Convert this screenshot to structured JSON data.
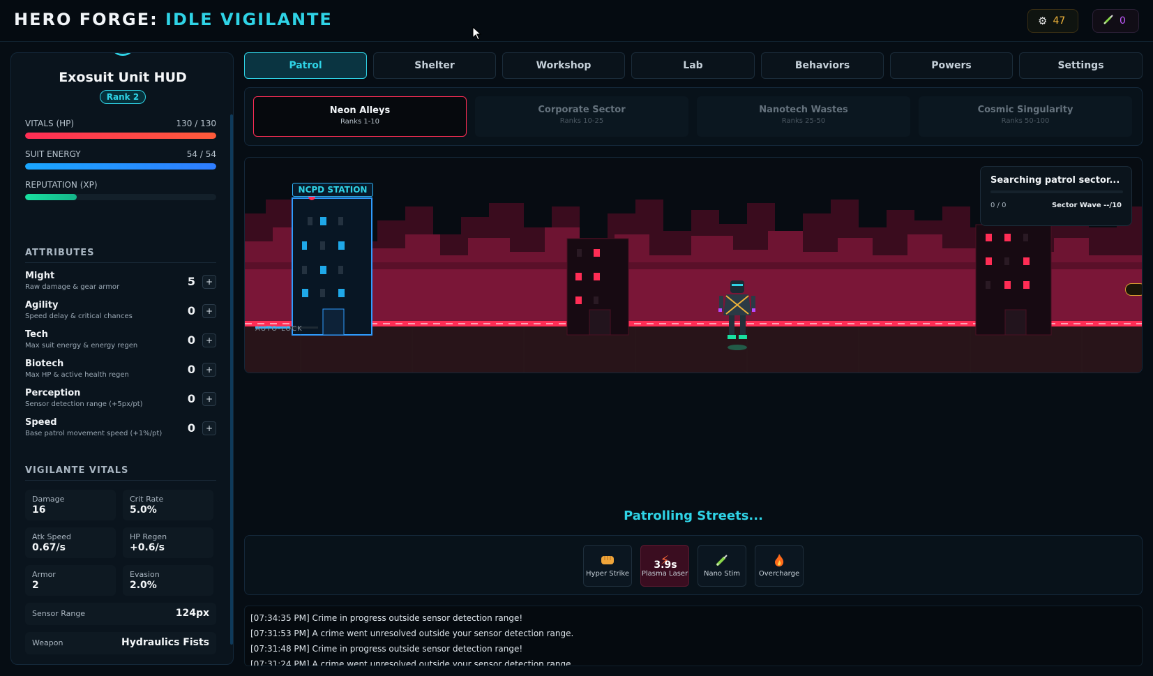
{
  "header": {
    "title_main": "HERO FORGE:",
    "title_accent": "IDLE VIGILANTE",
    "gears_count": "47",
    "syringe_count": "0",
    "gears_icon": "gear-icon",
    "syringe_icon": "syringe-icon"
  },
  "hud": {
    "title": "Exosuit Unit HUD",
    "rank": "Rank 2",
    "vitals_label": "VITALS (HP)",
    "vitals_value": "130 / 130",
    "vitals_fraction": 1.0,
    "energy_label": "SUIT ENERGY",
    "energy_value": "54 / 54",
    "energy_fraction": 1.0,
    "xp_label": "REPUTATION (XP)",
    "xp_fraction": 0.27
  },
  "attributes": {
    "heading": "ATTRIBUTES",
    "items": [
      {
        "name": "Might",
        "desc": "Raw damage & gear armor",
        "value": "5"
      },
      {
        "name": "Agility",
        "desc": "Speed delay & critical chances",
        "value": "0"
      },
      {
        "name": "Tech",
        "desc": "Max suit energy & energy regen",
        "value": "0"
      },
      {
        "name": "Biotech",
        "desc": "Max HP & active health regen",
        "value": "0"
      },
      {
        "name": "Perception",
        "desc": "Sensor detection range (+5px/pt)",
        "value": "0"
      },
      {
        "name": "Speed",
        "desc": "Base patrol movement speed (+1%/pt)",
        "value": "0"
      }
    ],
    "plus_label": "+"
  },
  "vitals": {
    "heading": "VIGILANTE VITALS",
    "stats": [
      {
        "label": "Damage",
        "value": "16"
      },
      {
        "label": "Crit Rate",
        "value": "5.0%"
      },
      {
        "label": "Atk Speed",
        "value": "0.67/s"
      },
      {
        "label": "HP Regen",
        "value": "+0.6/s"
      },
      {
        "label": "Armor",
        "value": "2"
      },
      {
        "label": "Evasion",
        "value": "2.0%"
      }
    ],
    "sensor_label": "Sensor Range",
    "sensor_value": "124px",
    "weapon_label": "Weapon",
    "weapon_value": "Hydraulics Fists"
  },
  "tabs": [
    "Patrol",
    "Shelter",
    "Workshop",
    "Lab",
    "Behaviors",
    "Powers",
    "Settings"
  ],
  "sectors": [
    {
      "name": "Neon Alleys",
      "ranks": "Ranks 1-10"
    },
    {
      "name": "Corporate Sector",
      "ranks": "Ranks 10-25"
    },
    {
      "name": "Nanotech Wastes",
      "ranks": "Ranks 25-50"
    },
    {
      "name": "Cosmic Singularity",
      "ranks": "Ranks 50-100"
    }
  ],
  "scene": {
    "station_label": "NCPD STATION",
    "autolock_label": "AUTO-LOCK",
    "search_title": "Searching patrol sector...",
    "search_count": "0 / 0",
    "search_wave": "Sector Wave --/10",
    "colors": {
      "neon_pink": "#ff2d55",
      "cyan": "#2fd3e6",
      "city": "#4a1023"
    }
  },
  "status": {
    "text": "Patrolling Streets..."
  },
  "skills": [
    {
      "name": "Hyper Strike",
      "icon": "fist-icon",
      "cooldown": ""
    },
    {
      "name": "Plasma Laser",
      "icon": "laser-icon",
      "cooldown": "3.9s"
    },
    {
      "name": "Nano Stim",
      "icon": "syringe-icon",
      "cooldown": ""
    },
    {
      "name": "Overcharge",
      "icon": "flame-icon",
      "cooldown": ""
    }
  ],
  "log": [
    "[07:34:35 PM] Crime in progress outside sensor detection range!",
    "[07:31:53 PM] A crime went unresolved outside your sensor detection range.",
    "[07:31:48 PM] Crime in progress outside sensor detection range!",
    "[07:31:24 PM] A crime went unresolved outside your sensor detection range."
  ]
}
